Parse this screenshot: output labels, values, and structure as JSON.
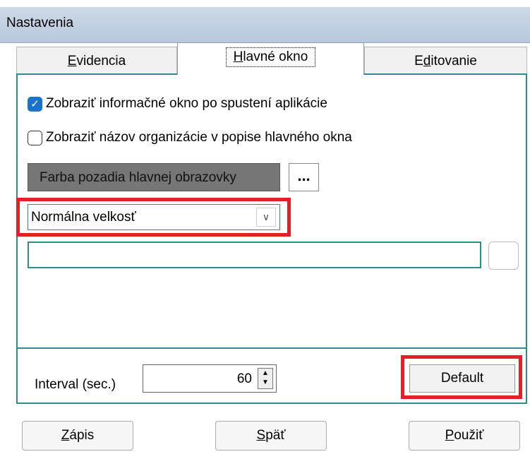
{
  "window": {
    "title": "Nastavenia"
  },
  "tabs": [
    {
      "pre": "",
      "key": "E",
      "post": "videncia"
    },
    {
      "pre": "",
      "key": "H",
      "post": "lavné okno"
    },
    {
      "pre": "E",
      "key": "d",
      "post": "itovanie"
    }
  ],
  "active_tab": 1,
  "options": {
    "show_info": {
      "label": "Zobraziť informačné okno po spustení aplikácie",
      "checked": true
    },
    "show_org": {
      "label": "Zobraziť názov organizácie v popise hlavného okna",
      "checked": false
    }
  },
  "background_color": {
    "label": "Farba pozadia hlavnej obrazovky",
    "ellipsis": "..."
  },
  "size_select": {
    "value": "Normálna velkosť"
  },
  "path_field": {
    "value": ""
  },
  "interval": {
    "label": "Interval (sec.)",
    "value": "60"
  },
  "default_button": {
    "label": "Default"
  },
  "buttons": {
    "zapis": {
      "pre": "",
      "key": "Z",
      "post": "ápis"
    },
    "spat": {
      "pre": "",
      "key": "S",
      "post": "päť"
    },
    "pouzit": {
      "pre": "",
      "key": "P",
      "post": "oužiť"
    }
  },
  "colors": {
    "accent_border": "#2e8b8b",
    "highlight": "#e51e2a",
    "checkbox_on": "#1a73c8"
  }
}
